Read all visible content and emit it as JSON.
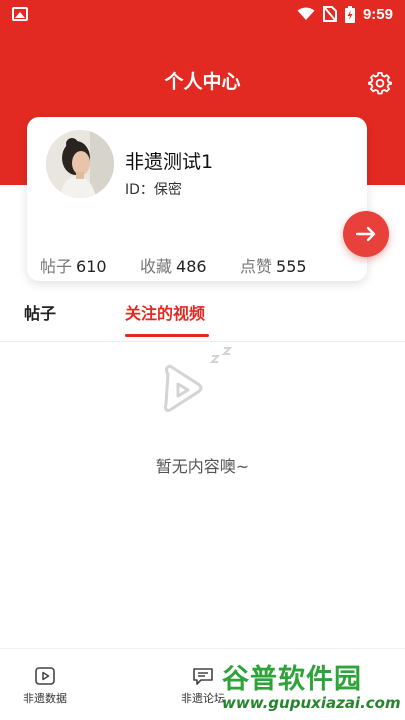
{
  "status_bar": {
    "time": "9:59"
  },
  "header": {
    "title": "个人中心"
  },
  "profile": {
    "username": "非遗测试1",
    "id_line": "ID：保密",
    "stats": [
      {
        "label": "帖子",
        "value": "610"
      },
      {
        "label": "收藏",
        "value": "486"
      },
      {
        "label": "点赞",
        "value": "555"
      }
    ]
  },
  "tabs": [
    {
      "label": "帖子",
      "active": false
    },
    {
      "label": "关注的视频",
      "active": true
    }
  ],
  "empty_state": {
    "text": "暂无内容噢~"
  },
  "bottom_nav": [
    {
      "label": "非遗数据",
      "icon": "play-box-icon"
    },
    {
      "label": "非遗论坛",
      "icon": "chat-icon"
    }
  ],
  "watermark": {
    "logo": "谷普软件园",
    "url": "www.gupuxiazai.com"
  },
  "colors": {
    "brand_red": "#e32a22",
    "button_red": "#e8403a",
    "watermark_green": "#2ea33a"
  }
}
